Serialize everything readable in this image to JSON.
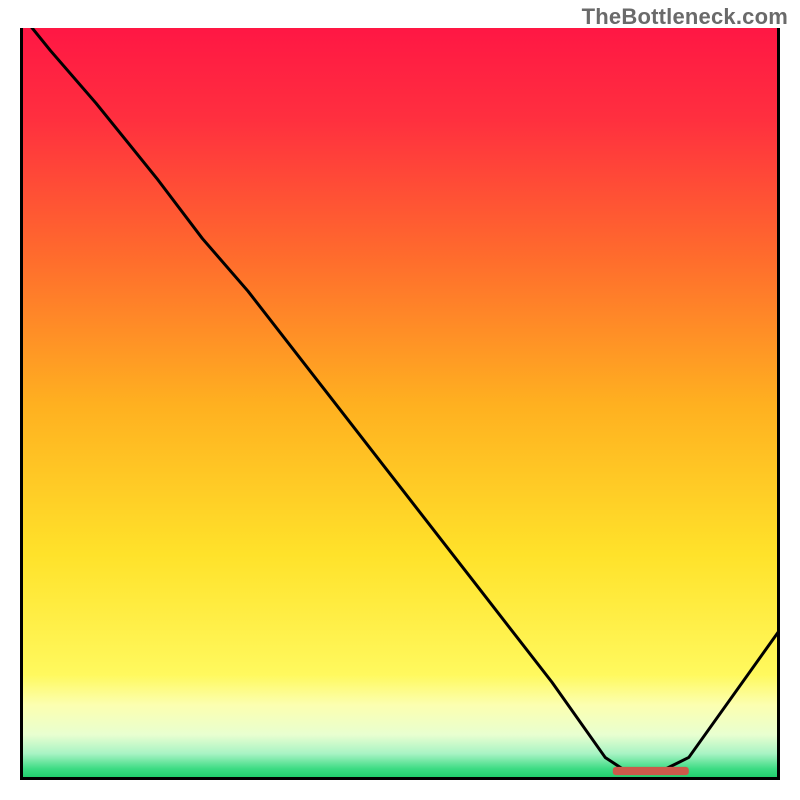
{
  "watermark": "TheBottleneck.com",
  "chart_data": {
    "type": "line",
    "title": "",
    "xlabel": "",
    "ylabel": "",
    "xlim": [
      0,
      100
    ],
    "ylim": [
      0,
      100
    ],
    "grid": false,
    "legend": false,
    "gradient_stops": [
      {
        "offset": 0.0,
        "color": "#ff1744"
      },
      {
        "offset": 0.12,
        "color": "#ff2f3f"
      },
      {
        "offset": 0.3,
        "color": "#ff6a2d"
      },
      {
        "offset": 0.5,
        "color": "#ffb020"
      },
      {
        "offset": 0.7,
        "color": "#ffe22a"
      },
      {
        "offset": 0.86,
        "color": "#fff95e"
      },
      {
        "offset": 0.9,
        "color": "#fcffb0"
      },
      {
        "offset": 0.94,
        "color": "#e8ffd0"
      },
      {
        "offset": 0.965,
        "color": "#a8f3c4"
      },
      {
        "offset": 0.985,
        "color": "#3ddc84"
      },
      {
        "offset": 1.0,
        "color": "#17c964"
      }
    ],
    "series": [
      {
        "name": "bottleneck-curve",
        "color": "#000000",
        "x": [
          0,
          4,
          10,
          18,
          24,
          30,
          40,
          50,
          60,
          70,
          77,
          80,
          84,
          88,
          100
        ],
        "y": [
          102,
          97,
          90,
          80,
          72,
          65,
          52,
          39,
          26,
          13,
          3,
          1,
          1,
          3,
          20
        ]
      }
    ],
    "marker": {
      "name": "optimal-range",
      "color": "#cc5a4a",
      "x_start": 78,
      "x_end": 88,
      "y": 1.2,
      "thickness": 1.1
    },
    "axis": {
      "stroke": "#000000",
      "width": 3
    }
  }
}
